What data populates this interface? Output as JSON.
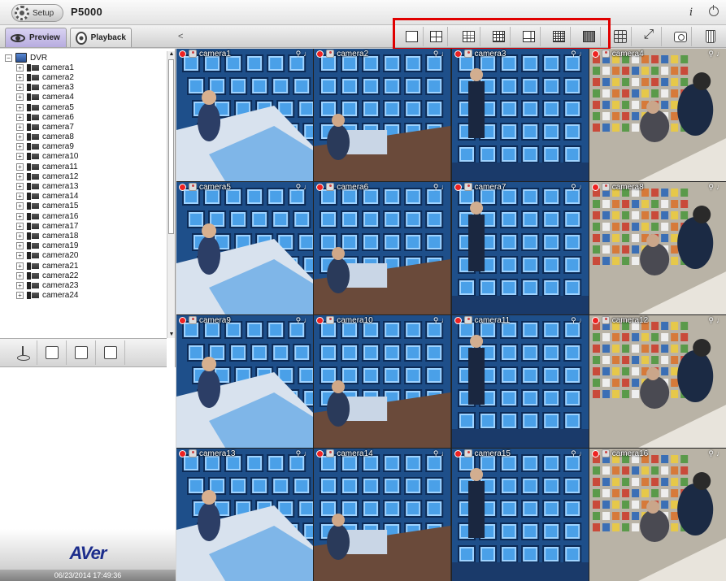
{
  "app": {
    "setup_label": "Setup",
    "model": "P5000",
    "info_glyph": "i",
    "datetime": "06/23/2014 17:49:36",
    "logo": "AVer"
  },
  "tabs": {
    "preview": "Preview",
    "playback": "Playback"
  },
  "toolbar": {
    "collapse_glyph": "<",
    "layouts": [
      {
        "name": "layout-1-button",
        "icon": "single-view-icon"
      },
      {
        "name": "layout-4-button",
        "icon": "quad-view-icon"
      },
      {
        "name": "layout-9-button",
        "icon": "nine-view-icon"
      },
      {
        "name": "layout-16-button",
        "icon": "sixteen-view-icon"
      },
      {
        "name": "layout-6-button",
        "icon": "six-view-icon"
      },
      {
        "name": "layout-25-button",
        "icon": "twenty-five-view-icon"
      },
      {
        "name": "layout-36-button",
        "icon": "thirty-six-view-icon"
      }
    ],
    "tools": [
      {
        "name": "custom-layout-button",
        "icon": "grid-add-icon"
      },
      {
        "name": "fullscreen-button",
        "icon": "expand-icon"
      },
      {
        "name": "snapshot-button",
        "icon": "camera-icon"
      },
      {
        "name": "delete-button",
        "icon": "trash-icon"
      }
    ],
    "highlight_color": "#e00000"
  },
  "tree": {
    "root": "DVR",
    "cameras": [
      "camera1",
      "camera2",
      "camera3",
      "camera4",
      "camera5",
      "camera6",
      "camera7",
      "camera8",
      "camera9",
      "camera10",
      "camera11",
      "camera12",
      "camera13",
      "camera14",
      "camera15",
      "camera16",
      "camera17",
      "camera18",
      "camera19",
      "camera20",
      "camera21",
      "camera22",
      "camera23",
      "camera24"
    ]
  },
  "sidebar_tools": [
    {
      "name": "ptz-button",
      "icon": "joystick-icon"
    },
    {
      "name": "playback-search-button",
      "icon": "search-doc-icon"
    },
    {
      "name": "sos-button",
      "icon": "sos-icon"
    },
    {
      "name": "pos-button",
      "icon": "pos-icon"
    }
  ],
  "grid": {
    "channels": [
      "camera1",
      "camera2",
      "camera3",
      "camera4",
      "camera5",
      "camera6",
      "camera7",
      "camera8",
      "camera9",
      "camera10",
      "camera11",
      "camera12",
      "camera13",
      "camera14",
      "camera15",
      "camera16"
    ],
    "scene_types": [
      "control-room",
      "monitor-wall",
      "monitor-wall-person",
      "store-robbery"
    ]
  },
  "colors": {
    "preview_tab": "#c7bfe9",
    "brand": "#1c2d8c"
  }
}
